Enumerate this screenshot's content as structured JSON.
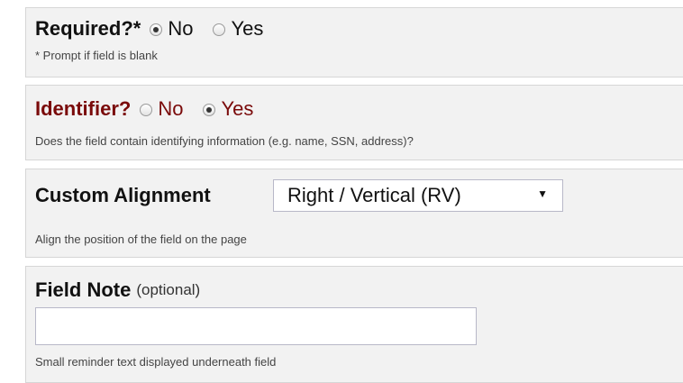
{
  "required": {
    "label": "Required?*",
    "options": [
      "No",
      "Yes"
    ],
    "selected": "No",
    "help": "* Prompt if field is blank"
  },
  "identifier": {
    "label": "Identifier?",
    "options": [
      "No",
      "Yes"
    ],
    "selected": "Yes",
    "help": "Does the field contain identifying information (e.g. name, SSN, address)?",
    "accent_color": "#7a0a0a"
  },
  "alignment": {
    "label": "Custom Alignment",
    "selected_value": "Right / Vertical (RV)",
    "help": "Align the position of the field on the page"
  },
  "field_note": {
    "label": "Field Note",
    "optional_text": "(optional)",
    "value": "",
    "help": "Small reminder text displayed underneath field"
  }
}
